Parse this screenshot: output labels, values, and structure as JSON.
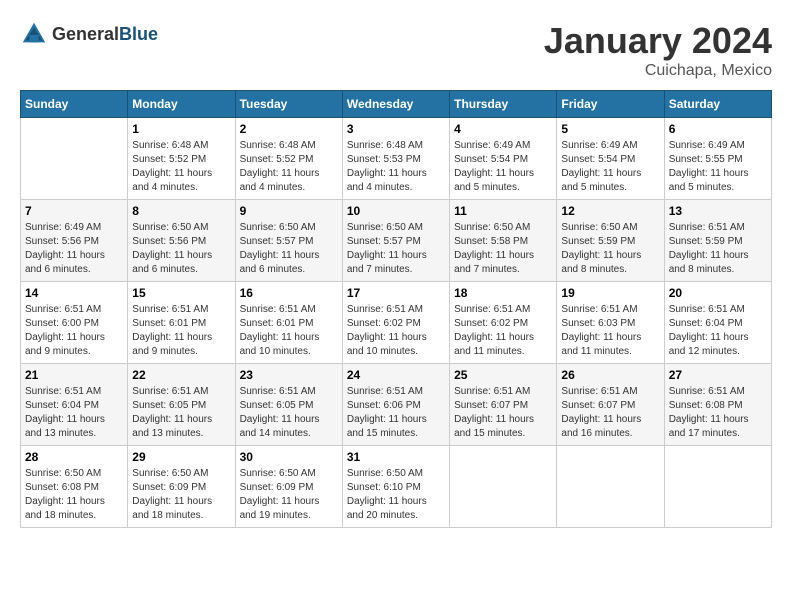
{
  "logo": {
    "text_general": "General",
    "text_blue": "Blue"
  },
  "header": {
    "month": "January 2024",
    "location": "Cuichapa, Mexico"
  },
  "weekdays": [
    "Sunday",
    "Monday",
    "Tuesday",
    "Wednesday",
    "Thursday",
    "Friday",
    "Saturday"
  ],
  "weeks": [
    [
      {
        "day": "",
        "sunrise": "",
        "sunset": "",
        "daylight": ""
      },
      {
        "day": "1",
        "sunrise": "Sunrise: 6:48 AM",
        "sunset": "Sunset: 5:52 PM",
        "daylight": "Daylight: 11 hours and 4 minutes."
      },
      {
        "day": "2",
        "sunrise": "Sunrise: 6:48 AM",
        "sunset": "Sunset: 5:52 PM",
        "daylight": "Daylight: 11 hours and 4 minutes."
      },
      {
        "day": "3",
        "sunrise": "Sunrise: 6:48 AM",
        "sunset": "Sunset: 5:53 PM",
        "daylight": "Daylight: 11 hours and 4 minutes."
      },
      {
        "day": "4",
        "sunrise": "Sunrise: 6:49 AM",
        "sunset": "Sunset: 5:54 PM",
        "daylight": "Daylight: 11 hours and 5 minutes."
      },
      {
        "day": "5",
        "sunrise": "Sunrise: 6:49 AM",
        "sunset": "Sunset: 5:54 PM",
        "daylight": "Daylight: 11 hours and 5 minutes."
      },
      {
        "day": "6",
        "sunrise": "Sunrise: 6:49 AM",
        "sunset": "Sunset: 5:55 PM",
        "daylight": "Daylight: 11 hours and 5 minutes."
      }
    ],
    [
      {
        "day": "7",
        "sunrise": "Sunrise: 6:49 AM",
        "sunset": "Sunset: 5:56 PM",
        "daylight": "Daylight: 11 hours and 6 minutes."
      },
      {
        "day": "8",
        "sunrise": "Sunrise: 6:50 AM",
        "sunset": "Sunset: 5:56 PM",
        "daylight": "Daylight: 11 hours and 6 minutes."
      },
      {
        "day": "9",
        "sunrise": "Sunrise: 6:50 AM",
        "sunset": "Sunset: 5:57 PM",
        "daylight": "Daylight: 11 hours and 6 minutes."
      },
      {
        "day": "10",
        "sunrise": "Sunrise: 6:50 AM",
        "sunset": "Sunset: 5:57 PM",
        "daylight": "Daylight: 11 hours and 7 minutes."
      },
      {
        "day": "11",
        "sunrise": "Sunrise: 6:50 AM",
        "sunset": "Sunset: 5:58 PM",
        "daylight": "Daylight: 11 hours and 7 minutes."
      },
      {
        "day": "12",
        "sunrise": "Sunrise: 6:50 AM",
        "sunset": "Sunset: 5:59 PM",
        "daylight": "Daylight: 11 hours and 8 minutes."
      },
      {
        "day": "13",
        "sunrise": "Sunrise: 6:51 AM",
        "sunset": "Sunset: 5:59 PM",
        "daylight": "Daylight: 11 hours and 8 minutes."
      }
    ],
    [
      {
        "day": "14",
        "sunrise": "Sunrise: 6:51 AM",
        "sunset": "Sunset: 6:00 PM",
        "daylight": "Daylight: 11 hours and 9 minutes."
      },
      {
        "day": "15",
        "sunrise": "Sunrise: 6:51 AM",
        "sunset": "Sunset: 6:01 PM",
        "daylight": "Daylight: 11 hours and 9 minutes."
      },
      {
        "day": "16",
        "sunrise": "Sunrise: 6:51 AM",
        "sunset": "Sunset: 6:01 PM",
        "daylight": "Daylight: 11 hours and 10 minutes."
      },
      {
        "day": "17",
        "sunrise": "Sunrise: 6:51 AM",
        "sunset": "Sunset: 6:02 PM",
        "daylight": "Daylight: 11 hours and 10 minutes."
      },
      {
        "day": "18",
        "sunrise": "Sunrise: 6:51 AM",
        "sunset": "Sunset: 6:02 PM",
        "daylight": "Daylight: 11 hours and 11 minutes."
      },
      {
        "day": "19",
        "sunrise": "Sunrise: 6:51 AM",
        "sunset": "Sunset: 6:03 PM",
        "daylight": "Daylight: 11 hours and 11 minutes."
      },
      {
        "day": "20",
        "sunrise": "Sunrise: 6:51 AM",
        "sunset": "Sunset: 6:04 PM",
        "daylight": "Daylight: 11 hours and 12 minutes."
      }
    ],
    [
      {
        "day": "21",
        "sunrise": "Sunrise: 6:51 AM",
        "sunset": "Sunset: 6:04 PM",
        "daylight": "Daylight: 11 hours and 13 minutes."
      },
      {
        "day": "22",
        "sunrise": "Sunrise: 6:51 AM",
        "sunset": "Sunset: 6:05 PM",
        "daylight": "Daylight: 11 hours and 13 minutes."
      },
      {
        "day": "23",
        "sunrise": "Sunrise: 6:51 AM",
        "sunset": "Sunset: 6:05 PM",
        "daylight": "Daylight: 11 hours and 14 minutes."
      },
      {
        "day": "24",
        "sunrise": "Sunrise: 6:51 AM",
        "sunset": "Sunset: 6:06 PM",
        "daylight": "Daylight: 11 hours and 15 minutes."
      },
      {
        "day": "25",
        "sunrise": "Sunrise: 6:51 AM",
        "sunset": "Sunset: 6:07 PM",
        "daylight": "Daylight: 11 hours and 15 minutes."
      },
      {
        "day": "26",
        "sunrise": "Sunrise: 6:51 AM",
        "sunset": "Sunset: 6:07 PM",
        "daylight": "Daylight: 11 hours and 16 minutes."
      },
      {
        "day": "27",
        "sunrise": "Sunrise: 6:51 AM",
        "sunset": "Sunset: 6:08 PM",
        "daylight": "Daylight: 11 hours and 17 minutes."
      }
    ],
    [
      {
        "day": "28",
        "sunrise": "Sunrise: 6:50 AM",
        "sunset": "Sunset: 6:08 PM",
        "daylight": "Daylight: 11 hours and 18 minutes."
      },
      {
        "day": "29",
        "sunrise": "Sunrise: 6:50 AM",
        "sunset": "Sunset: 6:09 PM",
        "daylight": "Daylight: 11 hours and 18 minutes."
      },
      {
        "day": "30",
        "sunrise": "Sunrise: 6:50 AM",
        "sunset": "Sunset: 6:09 PM",
        "daylight": "Daylight: 11 hours and 19 minutes."
      },
      {
        "day": "31",
        "sunrise": "Sunrise: 6:50 AM",
        "sunset": "Sunset: 6:10 PM",
        "daylight": "Daylight: 11 hours and 20 minutes."
      },
      {
        "day": "",
        "sunrise": "",
        "sunset": "",
        "daylight": ""
      },
      {
        "day": "",
        "sunrise": "",
        "sunset": "",
        "daylight": ""
      },
      {
        "day": "",
        "sunrise": "",
        "sunset": "",
        "daylight": ""
      }
    ]
  ]
}
